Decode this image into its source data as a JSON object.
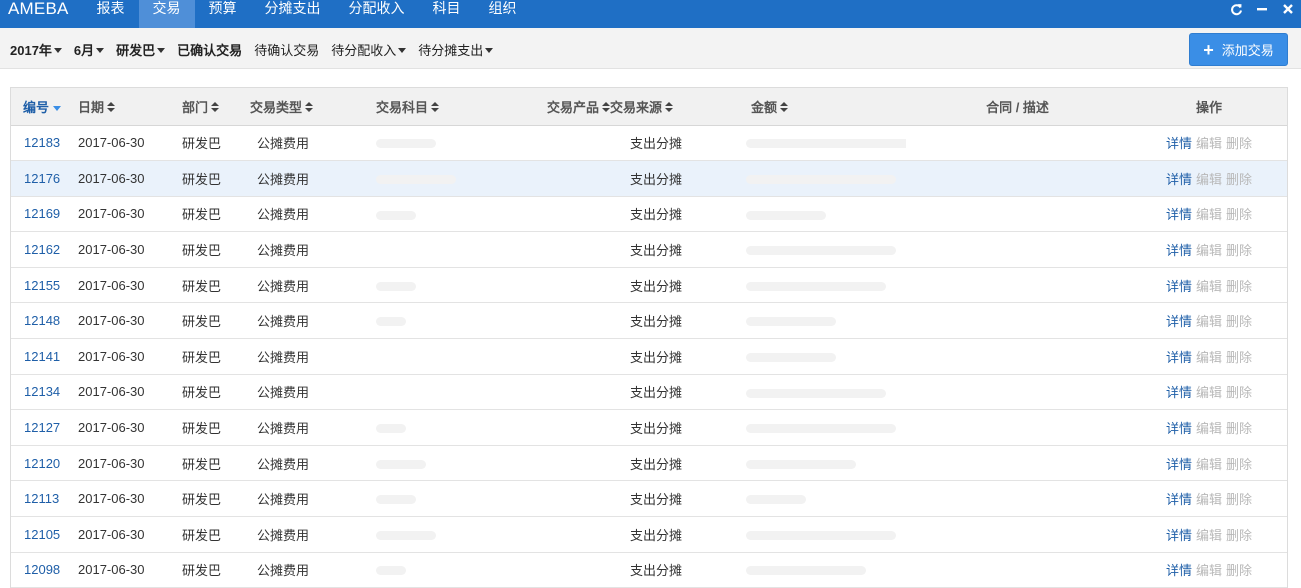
{
  "app": {
    "brand": "AMEBA"
  },
  "nav": {
    "items": [
      "报表",
      "交易",
      "预算",
      "分摊支出",
      "分配收入",
      "科目",
      "组织"
    ],
    "active": "交易"
  },
  "window_icons": [
    "refresh-icon",
    "minimize-icon",
    "close-icon"
  ],
  "filters": [
    {
      "label": "2017年",
      "dropdown": true,
      "bold": true
    },
    {
      "label": "6月",
      "dropdown": true,
      "bold": true
    },
    {
      "label": "研发巴",
      "dropdown": true,
      "bold": true
    },
    {
      "label": "已确认交易",
      "dropdown": false,
      "bold": true
    },
    {
      "label": "待确认交易",
      "dropdown": false,
      "bold": false
    },
    {
      "label": "待分配收入",
      "dropdown": true,
      "bold": false
    },
    {
      "label": "待分摊支出",
      "dropdown": true,
      "bold": false
    }
  ],
  "add_button": {
    "label": "添加交易",
    "icon": "plus-icon"
  },
  "table": {
    "columns": [
      {
        "key": "id",
        "label": "编号",
        "sort": "desc"
      },
      {
        "key": "date",
        "label": "日期",
        "sort": "both"
      },
      {
        "key": "dept",
        "label": "部门",
        "sort": "both"
      },
      {
        "key": "type",
        "label": "交易类型",
        "sort": "both"
      },
      {
        "key": "account",
        "label": "交易科目",
        "sort": "both"
      },
      {
        "key": "product",
        "label": "交易产品",
        "sort": "both"
      },
      {
        "key": "source",
        "label": "交易来源",
        "sort": "both"
      },
      {
        "key": "amount",
        "label": "金额",
        "sort": "both"
      },
      {
        "key": "desc",
        "label": "合同 / 描述",
        "sort": "none"
      },
      {
        "key": "actions",
        "label": "操作",
        "sort": "none"
      }
    ],
    "actions": [
      "详情",
      "编辑",
      "删除"
    ],
    "highlighted_row": 1,
    "rows": [
      {
        "id": "12183",
        "date": "2017-06-30",
        "dept": "研发巴",
        "type": "公摊费用",
        "account": "",
        "product": "",
        "source": "支出分摊",
        "amount": "",
        "desc": ""
      },
      {
        "id": "12176",
        "date": "2017-06-30",
        "dept": "研发巴",
        "type": "公摊费用",
        "account": "",
        "product": "",
        "source": "支出分摊",
        "amount": "",
        "desc": ""
      },
      {
        "id": "12169",
        "date": "2017-06-30",
        "dept": "研发巴",
        "type": "公摊费用",
        "account": "",
        "product": "",
        "source": "支出分摊",
        "amount": "",
        "desc": ""
      },
      {
        "id": "12162",
        "date": "2017-06-30",
        "dept": "研发巴",
        "type": "公摊费用",
        "account": "",
        "product": "",
        "source": "支出分摊",
        "amount": "",
        "desc": ""
      },
      {
        "id": "12155",
        "date": "2017-06-30",
        "dept": "研发巴",
        "type": "公摊费用",
        "account": "",
        "product": "",
        "source": "支出分摊",
        "amount": "",
        "desc": ""
      },
      {
        "id": "12148",
        "date": "2017-06-30",
        "dept": "研发巴",
        "type": "公摊费用",
        "account": "",
        "product": "",
        "source": "支出分摊",
        "amount": "",
        "desc": ""
      },
      {
        "id": "12141",
        "date": "2017-06-30",
        "dept": "研发巴",
        "type": "公摊费用",
        "account": "",
        "product": "",
        "source": "支出分摊",
        "amount": "",
        "desc": ""
      },
      {
        "id": "12134",
        "date": "2017-06-30",
        "dept": "研发巴",
        "type": "公摊费用",
        "account": "",
        "product": "",
        "source": "支出分摊",
        "amount": "",
        "desc": ""
      },
      {
        "id": "12127",
        "date": "2017-06-30",
        "dept": "研发巴",
        "type": "公摊费用",
        "account": "",
        "product": "",
        "source": "支出分摊",
        "amount": "",
        "desc": ""
      },
      {
        "id": "12120",
        "date": "2017-06-30",
        "dept": "研发巴",
        "type": "公摊费用",
        "account": "",
        "product": "",
        "source": "支出分摊",
        "amount": "",
        "desc": ""
      },
      {
        "id": "12113",
        "date": "2017-06-30",
        "dept": "研发巴",
        "type": "公摊费用",
        "account": "",
        "product": "",
        "source": "支出分摊",
        "amount": "",
        "desc": ""
      },
      {
        "id": "12105",
        "date": "2017-06-30",
        "dept": "研发巴",
        "type": "公摊费用",
        "account": "",
        "product": "",
        "source": "支出分摊",
        "amount": "",
        "desc": ""
      },
      {
        "id": "12098",
        "date": "2017-06-30",
        "dept": "研发巴",
        "type": "公摊费用",
        "account": "",
        "product": "",
        "source": "支出分摊",
        "amount": "",
        "desc": ""
      }
    ]
  }
}
